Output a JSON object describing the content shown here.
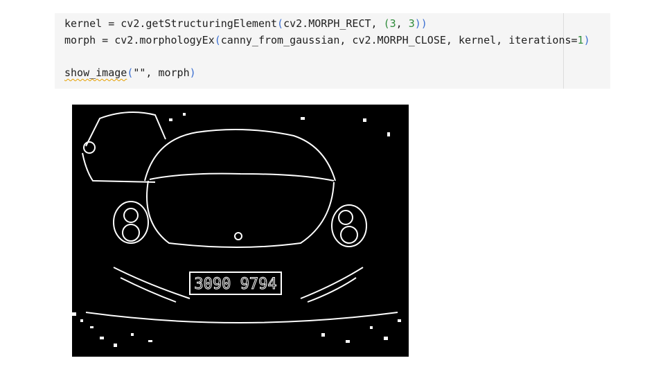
{
  "code": {
    "line1": {
      "pre": "kernel = cv2.getStructuringElement",
      "open": "(",
      "mid": "cv2.MORPH_RECT, ",
      "open2": "(",
      "n1": "3",
      "sep": ", ",
      "n2": "3",
      "close": "))"
    },
    "line2": {
      "pre": "morph = cv2.morphologyEx",
      "open": "(",
      "mid": "canny_from_gaussian, cv2.MORPH_CLOSE, kernel, iterations=",
      "num": "1",
      "close": ")"
    },
    "line4": {
      "fn": "show_image",
      "open": "(",
      "args": "\"\", morph",
      "close": ")"
    }
  },
  "output_image": {
    "plate_text": "3090 9794"
  }
}
